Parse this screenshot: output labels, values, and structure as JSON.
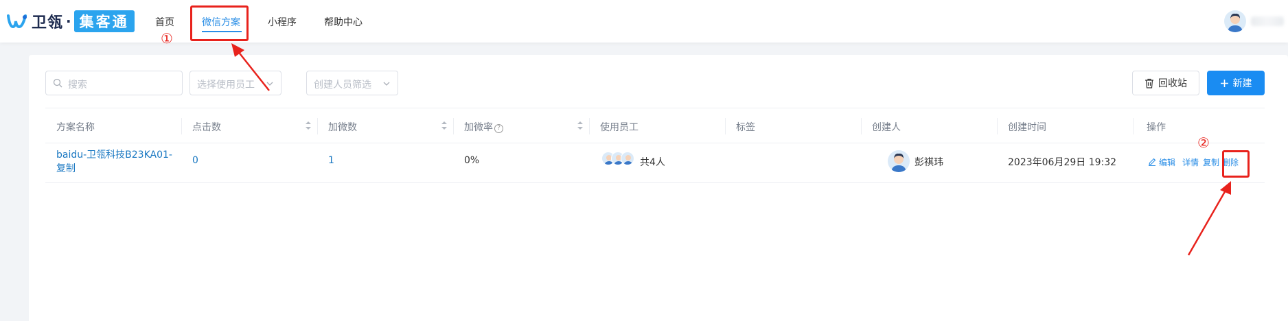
{
  "brand": {
    "logo_text": "卫瓴",
    "separator": "·",
    "product": "集客通",
    "accent_color": "#2ba4ee"
  },
  "nav": {
    "items": [
      {
        "label": "首页"
      },
      {
        "label": "微信方案",
        "active": true
      },
      {
        "label": "小程序"
      },
      {
        "label": "帮助中心"
      }
    ]
  },
  "toolbar": {
    "search_placeholder": "搜索",
    "employee_select_placeholder": "选择使用员工",
    "creator_select_placeholder": "创建人员筛选",
    "recycle_label": "回收站",
    "new_label": "新建"
  },
  "table": {
    "columns": [
      "方案名称",
      "点击数",
      "加微数",
      "加微率",
      "使用员工",
      "标签",
      "创建人",
      "创建时间",
      "操作"
    ],
    "rows": [
      {
        "name_line1": "baidu-卫瓴科技B23KA01-",
        "name_line2": "复制",
        "clicks": "0",
        "adds": "1",
        "rate": "0%",
        "employees": "共4人",
        "tags": "",
        "creator": "彭祺玮",
        "created_at": "2023年06月29日 19:32",
        "actions": [
          "编辑",
          "详情",
          "复制",
          "删除"
        ]
      }
    ]
  },
  "annotations": {
    "step1": "①",
    "step2": "②",
    "color": "#e8221c"
  }
}
